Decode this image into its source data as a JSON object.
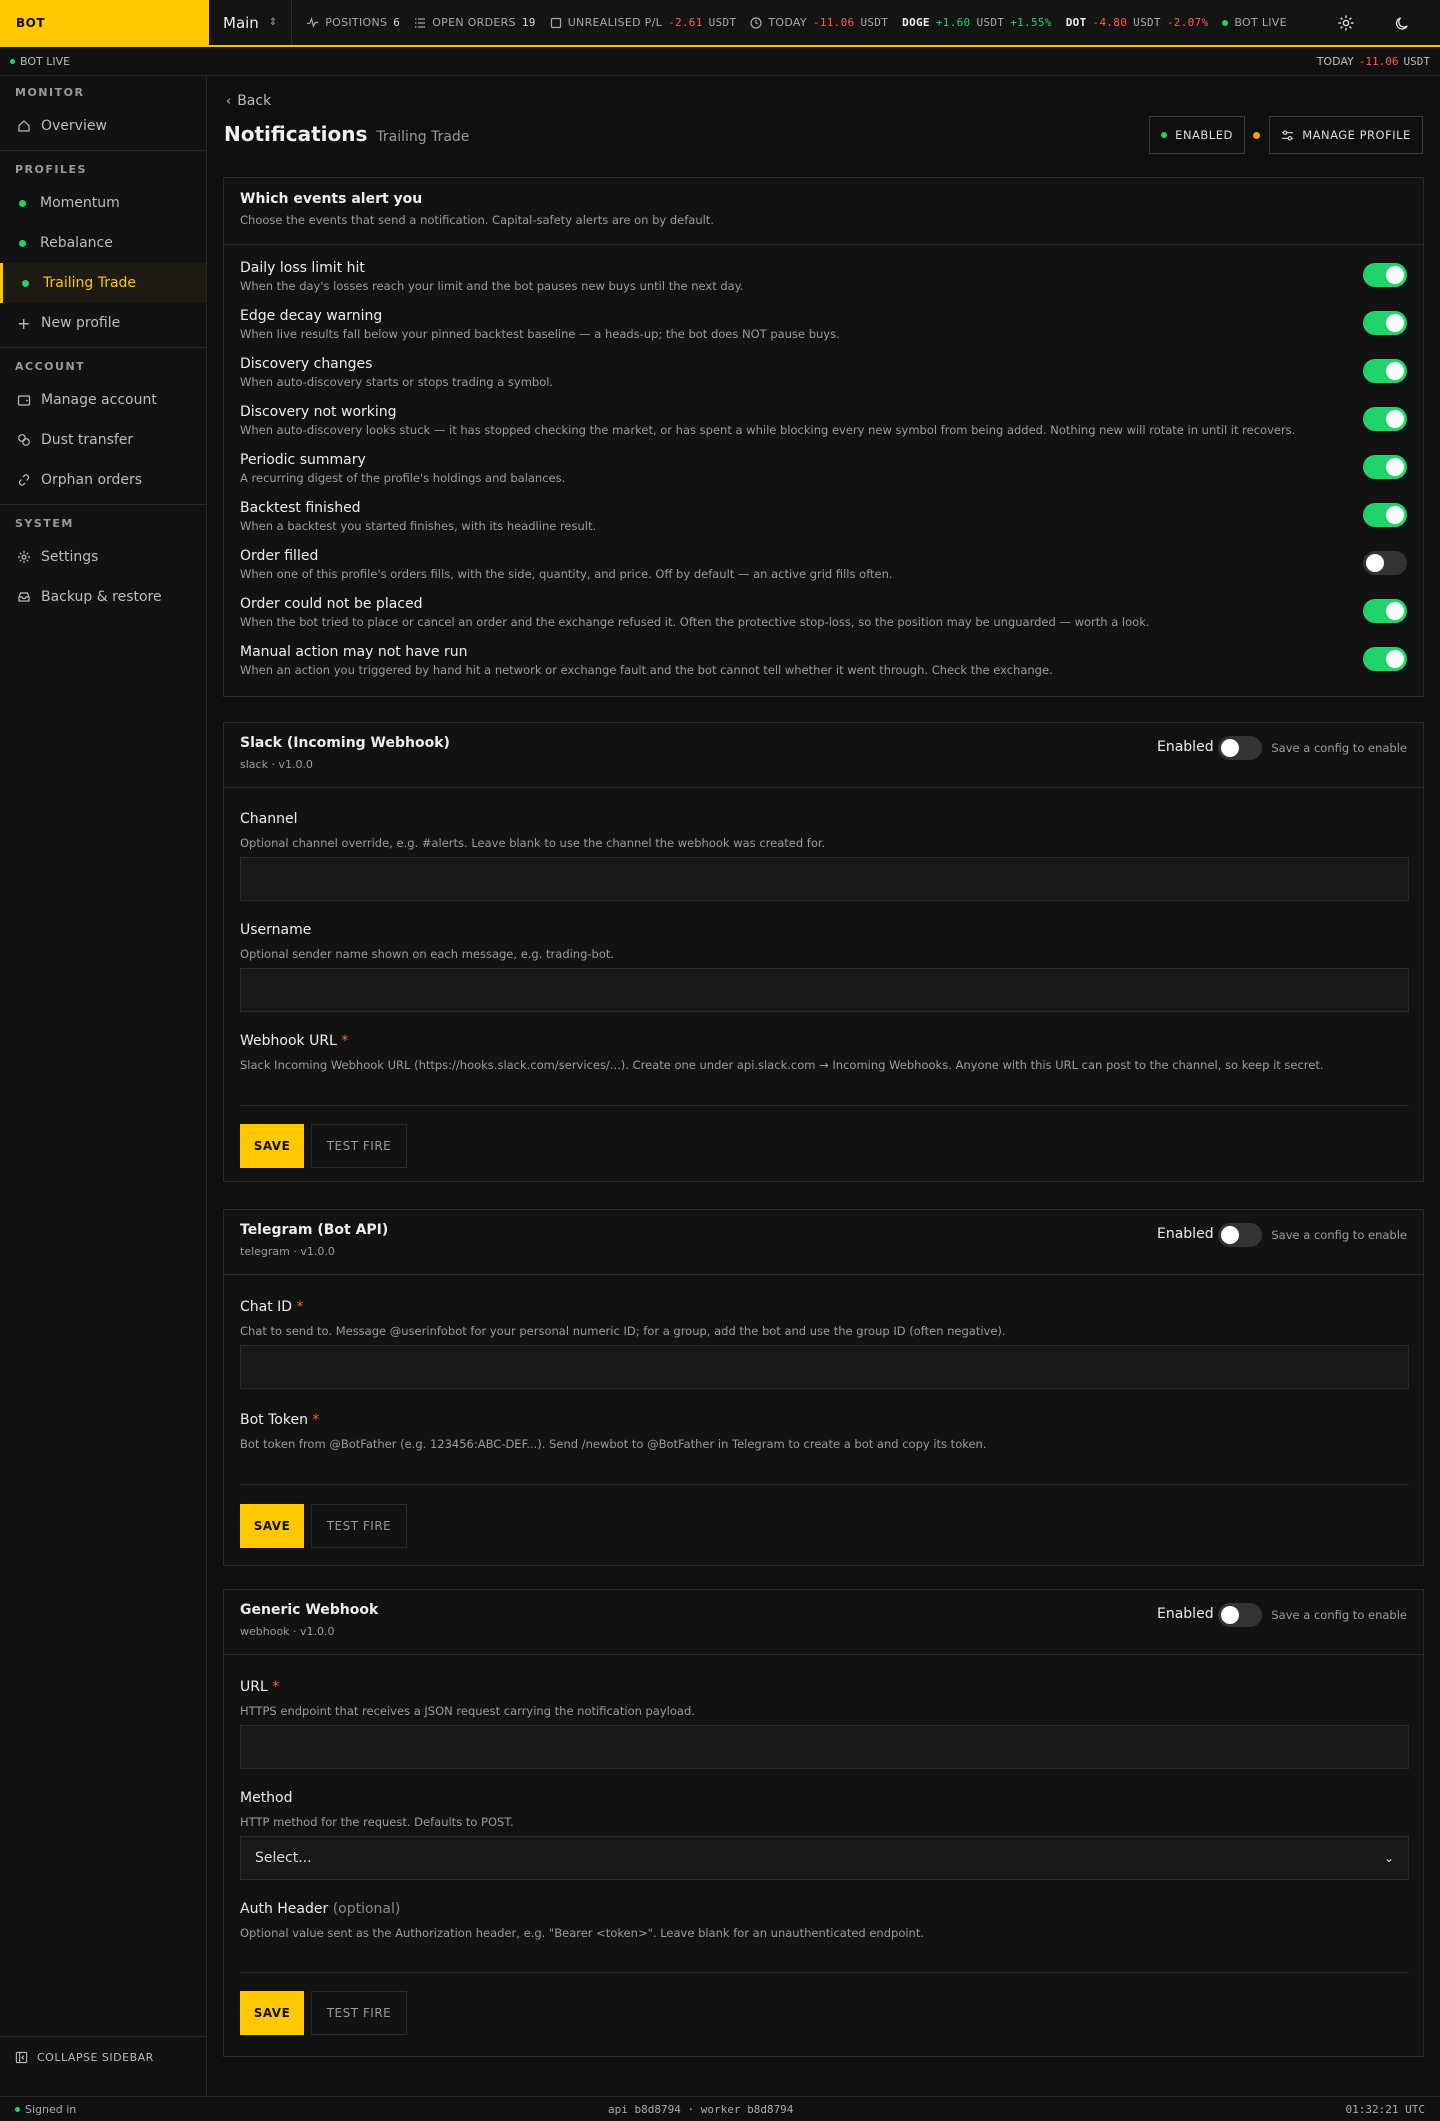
{
  "topbar": {
    "logo": "BOT",
    "workspace": "Main",
    "positions_label": "POSITIONS",
    "positions_value": "6",
    "orders_label": "OPEN ORDERS",
    "orders_value": "19",
    "upl_label": "UNREALISED P/L",
    "upl_value": "-2.61",
    "upl_unit": "USDT",
    "today_label": "TODAY",
    "today_value": "-11.06",
    "today_unit": "USDT",
    "doge_sym": "DOGE",
    "doge_val": "+1.60",
    "doge_unit": "USDT",
    "doge_pct": "+1.55%",
    "dot_sym": "DOT",
    "dot_val": "-4.80",
    "dot_unit": "USDT",
    "dot_pct": "-2.07%",
    "live": "BOT LIVE"
  },
  "subbar": {
    "live": "BOT LIVE",
    "today_label": "TODAY",
    "today_value": "-11.06",
    "today_unit": "USDT"
  },
  "sidebar": {
    "monitor": "MONITOR",
    "overview": "Overview",
    "profiles": "PROFILES",
    "momentum": "Momentum",
    "rebalance": "Rebalance",
    "trailing": "Trailing Trade",
    "new_profile": "New profile",
    "account": "ACCOUNT",
    "manage_account": "Manage account",
    "dust": "Dust transfer",
    "orphan": "Orphan orders",
    "system": "SYSTEM",
    "settings": "Settings",
    "backup": "Backup & restore",
    "collapse": "COLLAPSE SIDEBAR"
  },
  "header": {
    "back": "Back",
    "title": "Notifications",
    "subtitle": "Trailing Trade",
    "enabled": "ENABLED",
    "manage": "MANAGE PROFILE"
  },
  "events": {
    "title": "Which events alert you",
    "desc": "Choose the events that send a notification. Capital-safety alerts are on by default.",
    "items": [
      {
        "title": "Daily loss limit hit",
        "desc": "When the day's losses reach your limit and the bot pauses new buys until the next day.",
        "on": true
      },
      {
        "title": "Edge decay warning",
        "desc": "When live results fall below your pinned backtest baseline — a heads-up; the bot does NOT pause buys.",
        "on": true
      },
      {
        "title": "Discovery changes",
        "desc": "When auto-discovery starts or stops trading a symbol.",
        "on": true
      },
      {
        "title": "Discovery not working",
        "desc": "When auto-discovery looks stuck — it has stopped checking the market, or has spent a while blocking every new symbol from being added. Nothing new will rotate in until it recovers.",
        "on": true
      },
      {
        "title": "Periodic summary",
        "desc": "A recurring digest of the profile's holdings and balances.",
        "on": true
      },
      {
        "title": "Backtest finished",
        "desc": "When a backtest you started finishes, with its headline result.",
        "on": true
      },
      {
        "title": "Order filled",
        "desc": "When one of this profile's orders fills, with the side, quantity, and price. Off by default — an active grid fills often.",
        "on": false
      },
      {
        "title": "Order could not be placed",
        "desc": "When the bot tried to place or cancel an order and the exchange refused it. Often the protective stop-loss, so the position may be unguarded — worth a look.",
        "on": true
      },
      {
        "title": "Manual action may not have run",
        "desc": "When an action you triggered by hand hit a network or exchange fault and the bot cannot tell whether it went through. Check the exchange.",
        "on": true
      }
    ]
  },
  "slack": {
    "title": "Slack (Incoming Webhook)",
    "version": "slack · v1.0.0",
    "enabled": "Enabled",
    "hint": "Save a config to enable",
    "channel_label": "Channel",
    "channel_help": "Optional channel override, e.g. #alerts. Leave blank to use the channel the webhook was created for.",
    "username_label": "Username",
    "username_help": "Optional sender name shown on each message, e.g. trading-bot.",
    "webhook_label": "Webhook URL",
    "webhook_help": "Slack Incoming Webhook URL (https://hooks.slack.com/services/...). Create one under api.slack.com → Incoming Webhooks. Anyone with this URL can post to the channel, so keep it secret.",
    "save": "SAVE",
    "test": "TEST FIRE"
  },
  "telegram": {
    "title": "Telegram (Bot API)",
    "version": "telegram · v1.0.0",
    "enabled": "Enabled",
    "hint": "Save a config to enable",
    "chat_label": "Chat ID",
    "chat_help": "Chat to send to. Message @userinfobot for your personal numeric ID; for a group, add the bot and use the group ID (often negative).",
    "token_label": "Bot Token",
    "token_help": "Bot token from @BotFather (e.g. 123456:ABC-DEF...). Send /newbot to @BotFather in Telegram to create a bot and copy its token.",
    "save": "SAVE",
    "test": "TEST FIRE"
  },
  "webhook": {
    "title": "Generic Webhook",
    "version": "webhook · v1.0.0",
    "enabled": "Enabled",
    "hint": "Save a config to enable",
    "url_label": "URL",
    "url_help": "HTTPS endpoint that receives a JSON request carrying the notification payload.",
    "method_label": "Method",
    "method_help": "HTTP method for the request. Defaults to POST.",
    "method_value": "Select...",
    "auth_label": "Auth Header",
    "auth_optional": "(optional)",
    "auth_help": "Optional value sent as the Authorization header, e.g. \"Bearer <token>\". Leave blank for an unauthenticated endpoint.",
    "save": "SAVE",
    "test": "TEST FIRE"
  },
  "footer": {
    "signed": "Signed in",
    "build": "api b8d8794 · worker b8d8794",
    "time": "01:32:21 UTC"
  }
}
